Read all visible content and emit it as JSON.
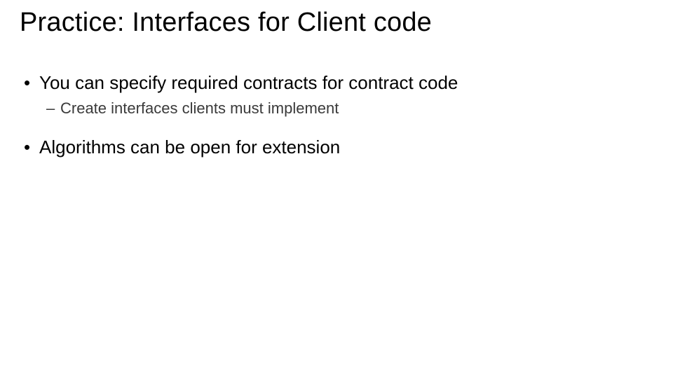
{
  "slide": {
    "title": "Practice: Interfaces for Client code",
    "bullets": [
      {
        "text": "You can specify required contracts for contract code",
        "sub": [
          {
            "text": "Create interfaces clients must implement"
          }
        ]
      },
      {
        "text": "Algorithms can be open for extension",
        "sub": []
      }
    ],
    "markers": {
      "level1": "•",
      "level2": "–"
    }
  }
}
